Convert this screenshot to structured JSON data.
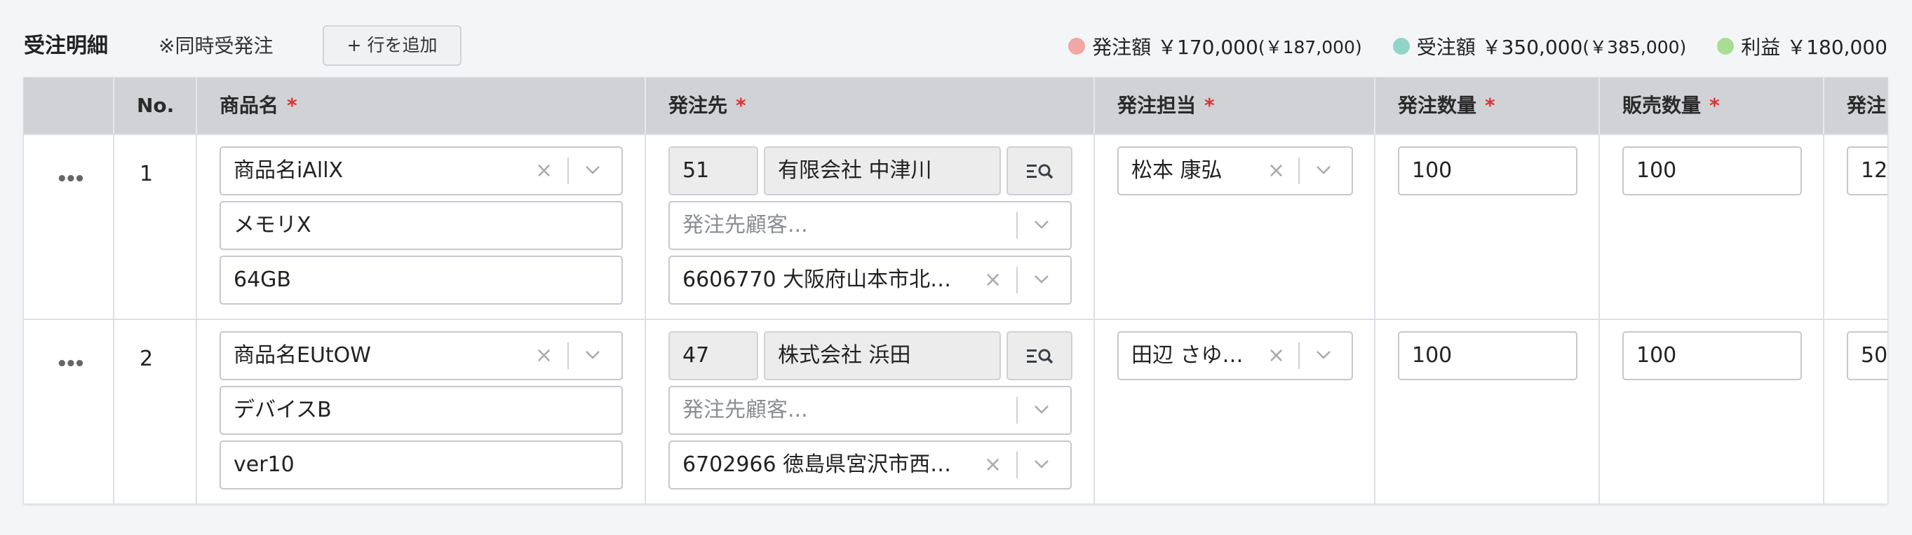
{
  "header": {
    "title": "受注明細",
    "note": "※同時受発注",
    "add_row_label": "+ 行を追加",
    "legend": [
      {
        "label": "発注額 ￥170,000",
        "paren": "(￥187,000)",
        "color": "#f2a7a7"
      },
      {
        "label": "受注額 ￥350,000",
        "paren": "(￥385,000)",
        "color": "#93d4c9"
      },
      {
        "label": "利益 ￥180,000",
        "paren": "",
        "color": "#a8dd95"
      }
    ]
  },
  "columns": {
    "no": "No.",
    "product": "商品名",
    "supplier": "発注先",
    "owner": "発注担当",
    "order_qty": "発注数量",
    "sales_qty": "販売数量",
    "next": "発注"
  },
  "required_mark": "*",
  "rows": [
    {
      "no": "1",
      "product_name": "商品名iAllX",
      "product_type": "メモリX",
      "product_spec": "64GB",
      "supplier_code": "51",
      "supplier_name": "有限会社 中津川",
      "customer_placeholder": "発注先顧客...",
      "address": "6606770 大阪府山本市北…",
      "owner": "松本 康弘",
      "order_qty": "100",
      "sales_qty": "100",
      "next_value": "12"
    },
    {
      "no": "2",
      "product_name": "商品名EUtOW",
      "product_type": "デバイスB",
      "product_spec": "ver10",
      "supplier_code": "47",
      "supplier_name": "株式会社 浜田",
      "customer_placeholder": "発注先顧客...",
      "address": "6702966 徳島県宮沢市西…",
      "owner": "田辺 さゆ…",
      "order_qty": "100",
      "sales_qty": "100",
      "next_value": "50"
    }
  ],
  "icons": {
    "clear": "×",
    "more": "•••"
  }
}
